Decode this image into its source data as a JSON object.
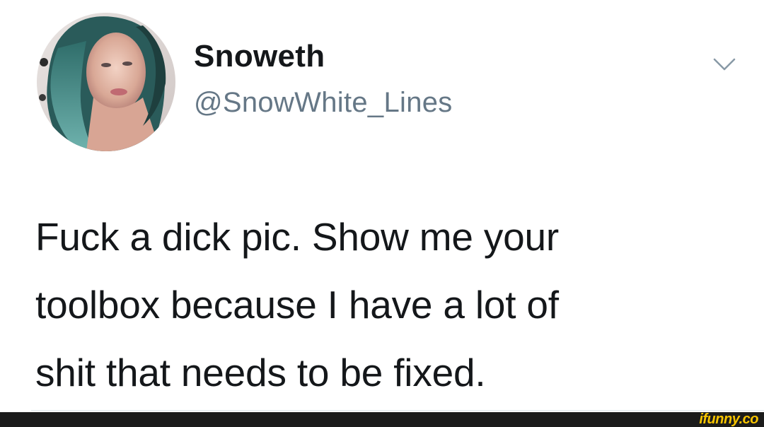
{
  "tweet": {
    "display_name": "Snoweth",
    "handle": "@SnowWhite_Lines",
    "text_lines": [
      "Fuck a dick pic. Show me your",
      "toolbox because I have a lot of",
      "shit that needs to be fixed."
    ],
    "icons": {
      "menu": "chevron-down-icon",
      "avatar": "profile-photo"
    }
  },
  "footer": {
    "watermark": "ifunny.co"
  },
  "colors": {
    "text": "#14171a",
    "handle": "#657786",
    "footer_bg": "#1b1b1b",
    "watermark": "#f7c400"
  }
}
